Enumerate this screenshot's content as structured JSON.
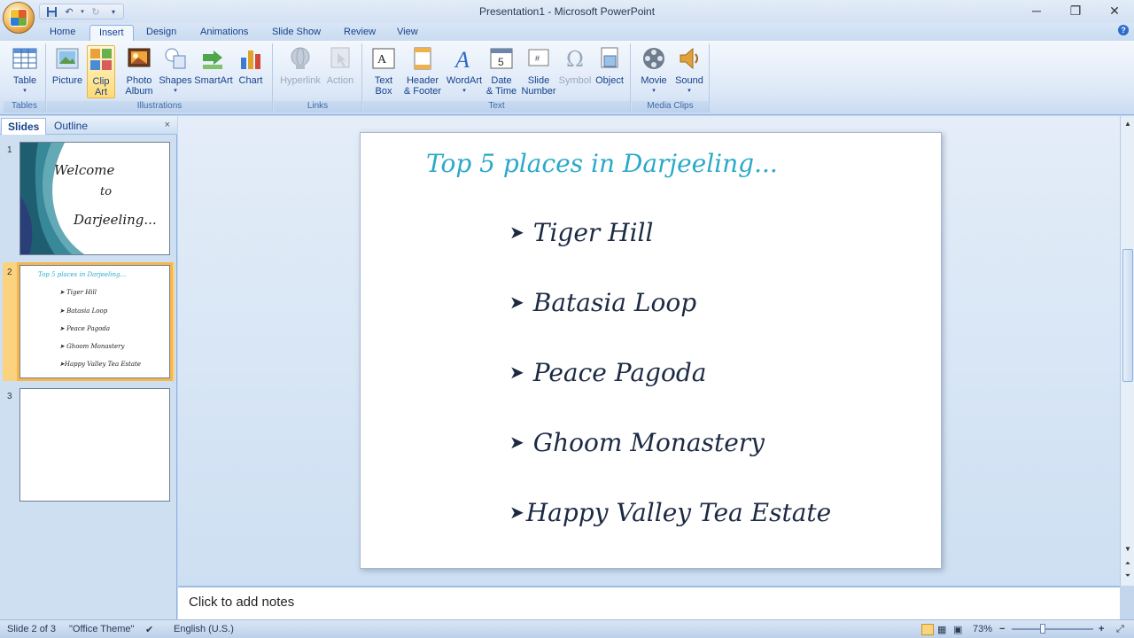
{
  "window": {
    "title": "Presentation1 - Microsoft PowerPoint",
    "minimize_icon": "minimize-icon",
    "maximize_icon": "restore-icon",
    "close_icon": "close-icon"
  },
  "quick_access": {
    "save_icon": "save-icon",
    "undo_icon": "undo-icon",
    "redo_icon": "redo-icon",
    "customize_icon": "dropdown-icon"
  },
  "tabs": [
    "Home",
    "Insert",
    "Design",
    "Animations",
    "Slide Show",
    "Review",
    "View"
  ],
  "active_tab": "Insert",
  "ribbon": {
    "groups": {
      "tables": "Tables",
      "illustrations": "Illustrations",
      "links": "Links",
      "text": "Text",
      "media": "Media Clips"
    },
    "buttons": {
      "table": [
        "Table",
        ""
      ],
      "picture": [
        "Picture",
        ""
      ],
      "clipart": [
        "Clip",
        "Art"
      ],
      "photo_album": [
        "Photo",
        "Album"
      ],
      "shapes": [
        "Shapes",
        ""
      ],
      "smartart": [
        "SmartArt",
        ""
      ],
      "chart": [
        "Chart",
        ""
      ],
      "hyperlink": [
        "Hyperlink",
        ""
      ],
      "action": [
        "Action",
        ""
      ],
      "textbox": [
        "Text",
        "Box"
      ],
      "header_footer": [
        "Header",
        "& Footer"
      ],
      "wordart": [
        "WordArt",
        ""
      ],
      "date_time": [
        "Date",
        "& Time"
      ],
      "slide_number": [
        "Slide",
        "Number"
      ],
      "symbol": [
        "Symbol",
        ""
      ],
      "object": [
        "Object",
        ""
      ],
      "movie": [
        "Movie",
        ""
      ],
      "sound": [
        "Sound",
        ""
      ]
    }
  },
  "left_pane": {
    "tabs": [
      "Slides",
      "Outline"
    ],
    "close": "×",
    "slide_numbers": [
      "1",
      "2",
      "3"
    ],
    "slide1": {
      "lines": [
        "Welcome",
        "to",
        "Darjeeling..."
      ]
    },
    "slide2": {
      "title": "Top 5 places in Darjeeling...",
      "bullets": [
        "Tiger Hill",
        "Batasia Loop",
        "Peace Pagoda",
        "Ghoom Monastery",
        "Happy Valley Tea Estate"
      ]
    }
  },
  "slide": {
    "title": "Top 5 places in Darjeeling...",
    "bullets": [
      "Tiger Hill",
      "Batasia Loop",
      "Peace Pagoda",
      "Ghoom Monastery",
      "Happy Valley Tea Estate"
    ],
    "bullet_glyph": "➤"
  },
  "notes": {
    "placeholder": "Click to add notes"
  },
  "status": {
    "slide_info": "Slide 2 of 3",
    "theme": "\"Office Theme\"",
    "language": "English (U.S.)",
    "zoom": "73%",
    "zoom_out": "−",
    "zoom_in": "+"
  },
  "colors": {
    "accent_title": "#2aa9c9",
    "selected_thumb": "#f7b64c",
    "ribbon_text": "#15428b"
  }
}
